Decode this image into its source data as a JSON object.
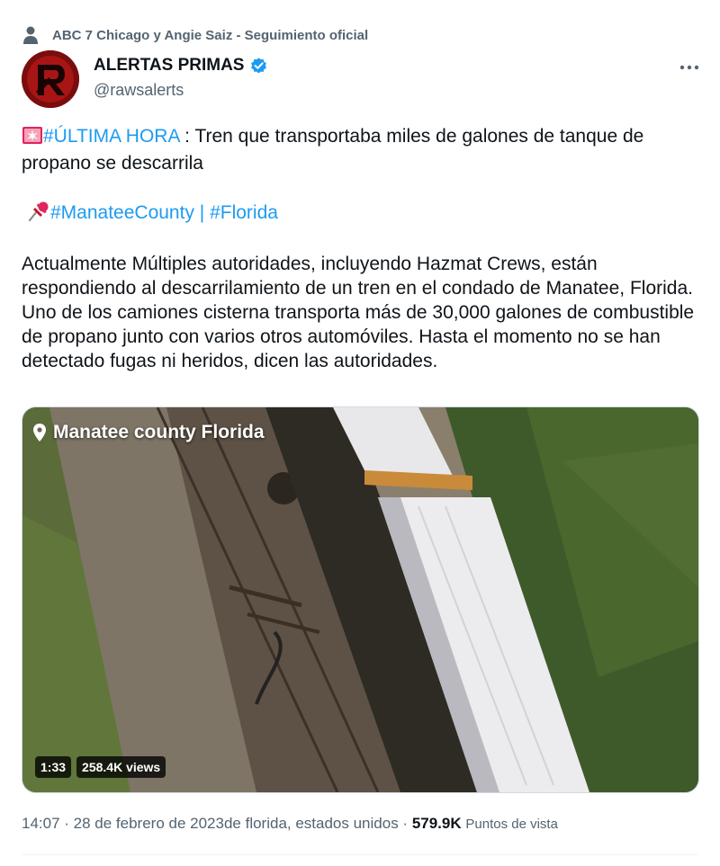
{
  "social_context": {
    "text": "ABC 7 Chicago y Angie Saiz - Seguimiento oficial",
    "icon": "person-icon"
  },
  "author": {
    "display_name": "ALERTAS PRIMAS",
    "handle": "@rawsalerts",
    "verified": true,
    "avatar_letter": "R"
  },
  "more_icon": "more-horizontal-icon",
  "tweet": {
    "line1": {
      "emoji_icon": "rotating-light-icon",
      "hashtag": "#ÚLTIMA HORA",
      "text": " : Tren que transportaba miles de galones de tanque de propano se descarrila"
    },
    "line2": {
      "emoji_icon": "pushpin-icon",
      "hashtag1": "#ManateeCounty",
      "separator": " | ",
      "hashtag2": "#Florida"
    },
    "body": "Actualmente Múltiples autoridades, incluyendo Hazmat Crews, están respondiendo al descarrilamiento de un tren en el condado de Manatee, Florida. Uno de los camiones cisterna transporta más de 30,000 galones de combustible de propano junto con varios otros automóviles. Hasta el momento no se han detectado fugas ni heridos, dicen las autoridades."
  },
  "video": {
    "location": "Manatee county Florida",
    "duration": "1:33",
    "views": "258.4K views"
  },
  "meta": {
    "time": "14:07",
    "dot": " · ",
    "date_place": "28 de febrero de 2023de florida, estados unidos",
    "views_count": "579.9K",
    "views_label": "Puntos de vista"
  },
  "colors": {
    "accent": "#1d9bf0",
    "muted": "#536471",
    "text": "#0f1419",
    "avatar_bg": "#7a0d0d"
  }
}
